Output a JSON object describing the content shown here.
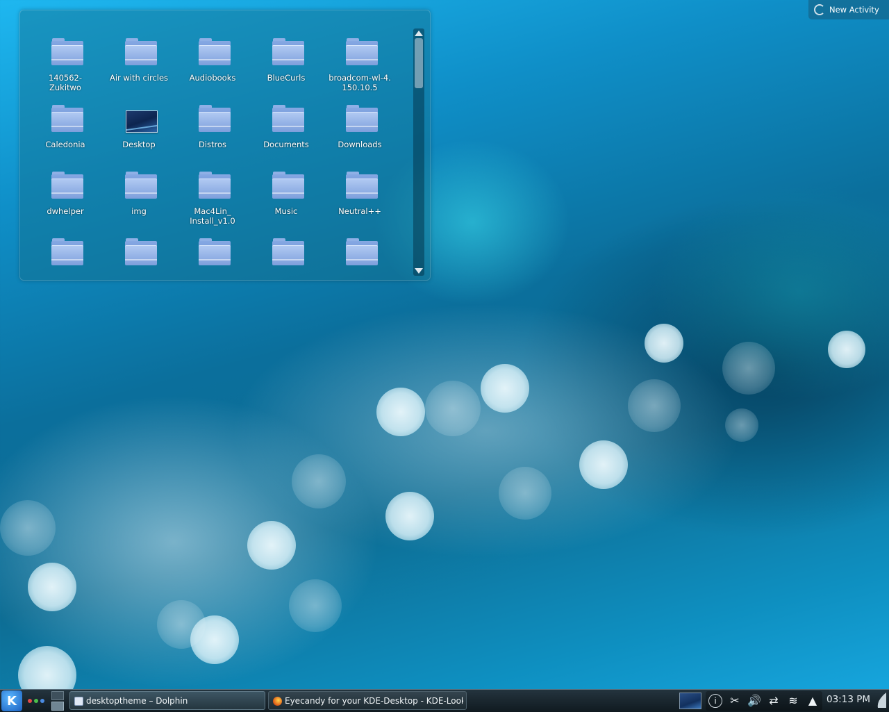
{
  "activity": {
    "label": "New Activity"
  },
  "folder_view": {
    "items": [
      {
        "label": "140562-\nZukitwo",
        "type": "folder"
      },
      {
        "label": "Air with circles",
        "type": "folder"
      },
      {
        "label": "Audiobooks",
        "type": "folder"
      },
      {
        "label": "BlueCurls",
        "type": "folder"
      },
      {
        "label": "broadcom-wl-4.\n150.10.5",
        "type": "folder"
      },
      {
        "label": "Caledonia",
        "type": "folder"
      },
      {
        "label": "Desktop",
        "type": "desktop"
      },
      {
        "label": "Distros",
        "type": "folder"
      },
      {
        "label": "Documents",
        "type": "folder"
      },
      {
        "label": "Downloads",
        "type": "folder"
      },
      {
        "label": "dwhelper",
        "type": "folder"
      },
      {
        "label": "img",
        "type": "folder"
      },
      {
        "label": "Mac4Lin_\nInstall_v1.0",
        "type": "folder"
      },
      {
        "label": "Music",
        "type": "folder"
      },
      {
        "label": "Neutral++",
        "type": "folder"
      },
      {
        "label": "",
        "type": "folder"
      },
      {
        "label": "",
        "type": "folder"
      },
      {
        "label": "",
        "type": "folder"
      },
      {
        "label": "",
        "type": "folder"
      },
      {
        "label": "",
        "type": "folder"
      }
    ]
  },
  "taskbar": {
    "tasks": [
      {
        "label": "desktoptheme – Dolphin",
        "icon": "dolphin-icon"
      },
      {
        "label": "Eyecandy for your KDE-Desktop - KDE-Look.o",
        "icon": "firefox-icon"
      }
    ]
  },
  "tray": {
    "icons": [
      "info-icon",
      "klipper-scissors-icon",
      "volume-icon",
      "network-icon",
      "wifi-icon",
      "expand-arrow-icon"
    ],
    "clock": "03:13 PM"
  },
  "colors": {
    "wallpaper_top": "#1eb7f0",
    "wallpaper_mid": "#0b6f9c",
    "panel": "#1a262d",
    "folder": "#8fb0e6"
  }
}
